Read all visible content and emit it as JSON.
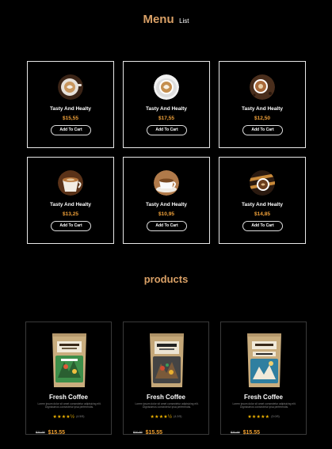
{
  "menu_heading": {
    "title": "Menu",
    "subtitle": "List"
  },
  "menu_items": [
    {
      "name": "Tasty And Healty",
      "price": "$15,55",
      "button": "Add To Cart",
      "image": "latte-art-cup-icon"
    },
    {
      "name": "Tasty And Healty",
      "price": "$17,55",
      "button": "Add To Cart",
      "image": "latte-cup-saucer-icon"
    },
    {
      "name": "Tasty And Healty",
      "price": "$12,50",
      "button": "Add To Cart",
      "image": "coffee-cup-top-view-icon"
    },
    {
      "name": "Tasty And Healty",
      "price": "$13,25",
      "button": "Add To Cart",
      "image": "coffee-cup-side-icon"
    },
    {
      "name": "Tasty And Healty",
      "price": "$10,95",
      "button": "Add To Cart",
      "image": "espresso-cup-icon"
    },
    {
      "name": "Tasty And Healty",
      "price": "$14,85",
      "button": "Add To Cart",
      "image": "coffee-beans-cup-icon"
    }
  ],
  "products_heading": "products",
  "products": [
    {
      "name": "Fresh Coffee",
      "description": "Lorem ipsum dolor sit amet consectetur adipisicing elit. Dignissimos consectetur ipsa perferendis.",
      "stars": "★★★★½",
      "reviews": "(4.5/5)",
      "old_price": "$20.99",
      "price": "$15.55",
      "bag_color": "#c9ad7e",
      "label_color": "#3d8f4a",
      "rating": 4.5
    },
    {
      "name": "Fresh Coffee",
      "description": "Lorem ipsum dolor sit amet consectetur adipisicing elit. Dignissimos consectetur ipsa perferendis.",
      "stars": "★★★★½",
      "reviews": "(4.2/5)",
      "old_price": "$20.99",
      "price": "$15.55",
      "bag_color": "#c4a778",
      "label_color": "#444444",
      "rating": 4.5
    },
    {
      "name": "Fresh Coffee",
      "description": "Lorem ipsum dolor sit amet consectetur adipisicing elit. Dignissimos consectetur ipsa perferendis.",
      "stars": "★★★★★",
      "reviews": "(5.0/5)",
      "old_price": "$20.99",
      "price": "$15.55",
      "bag_color": "#c9ad7e",
      "label_color": "#2f7fa0",
      "rating": 5
    }
  ],
  "colors": {
    "accent": "#d9a066",
    "price": "#f2a23a",
    "star": "#f0b400",
    "background": "#000000"
  }
}
